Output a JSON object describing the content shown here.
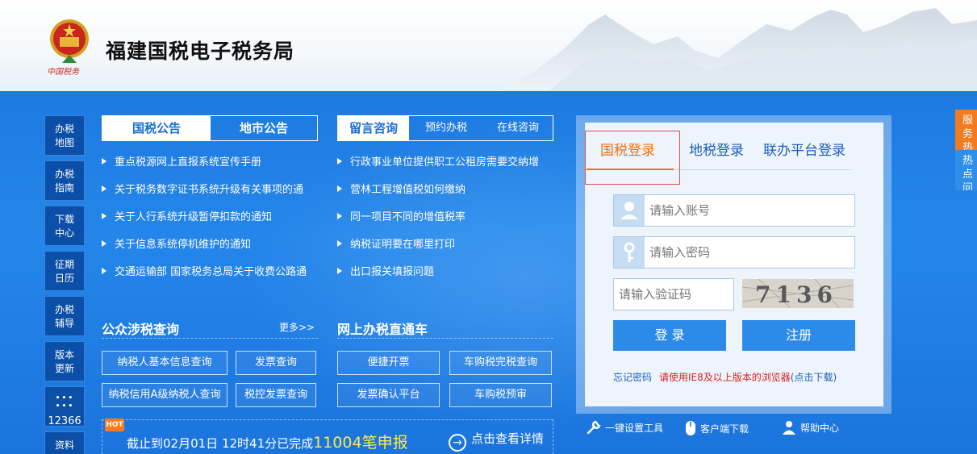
{
  "header": {
    "emblem_caption": "中国税务",
    "title": "福建国税电子税务局"
  },
  "sidebar": {
    "items": [
      {
        "line1": "办税",
        "line2": "地图"
      },
      {
        "line1": "办税",
        "line2": "指南"
      },
      {
        "line1": "下载",
        "line2": "中心"
      },
      {
        "line1": "征期",
        "line2": "日历"
      },
      {
        "line1": "办税",
        "line2": "辅导"
      },
      {
        "line1": "版本",
        "line2": "更新"
      },
      {
        "line1": "",
        "line2": "12366"
      },
      {
        "line1": "资料",
        "line2": ""
      }
    ]
  },
  "announcements": {
    "tabs": [
      "国税公告",
      "地市公告"
    ],
    "items": [
      "重点税源网上直报系统宣传手册",
      "关于税务数字证书系统升级有关事项的通",
      "关于人行系统升级暂停扣款的通知",
      "关于信息系统停机维护的通知",
      "交通运输部 国家税务总局关于收费公路通"
    ]
  },
  "consult": {
    "tabs": [
      "留言咨询",
      "预约办税",
      "在线咨询"
    ],
    "items": [
      "行政事业单位提供职工公租房需要交纳增",
      "营林工程增值税如何缴纳",
      "同一项目不同的增值税率",
      "纳税证明要在哪里打印",
      "出口报关填报问题"
    ]
  },
  "public_query": {
    "title": "公众涉税查询",
    "more": "更多>>",
    "buttons": [
      "纳税人基本信息查询",
      "发票查询",
      "纳税信用A级纳税人查询",
      "税控发票查询"
    ]
  },
  "online_tax": {
    "title": "网上办税直通车",
    "buttons": [
      "便捷开票",
      "车购税完税查询",
      "发票确认平台",
      "车购税预审"
    ]
  },
  "banner": {
    "hot": "HOT",
    "text_prefix": "截止到02月01日 12时41分已完成",
    "count": "11004笔申报",
    "detail": "点击查看详情"
  },
  "login": {
    "tabs": [
      "国税登录",
      "地税登录",
      "联办平台登录"
    ],
    "account_placeholder": "请输入账号",
    "password_placeholder": "请输入密码",
    "captcha_placeholder": "请输入验证码",
    "captcha_text": "7136",
    "login_button": "登 录",
    "register_button": "注册",
    "forgot": "忘记密码",
    "ie_note": "请使用IE8及以上版本的浏览器",
    "ie_download": "(点击下载)"
  },
  "tools": [
    "一键设置工具",
    "客户端下载",
    "帮助中心"
  ],
  "float_tabs": [
    {
      "line1": "服务",
      "line2": "热点",
      "color": "#f47a20"
    },
    {
      "line1": "热点",
      "line2": "问题",
      "color": "#2f8fe8"
    }
  ],
  "colors": {
    "primary_blue": "#1a73d8",
    "accent_orange": "#f07014",
    "alert_red": "#d81f1f",
    "highlight_yellow": "#ffe94a"
  }
}
